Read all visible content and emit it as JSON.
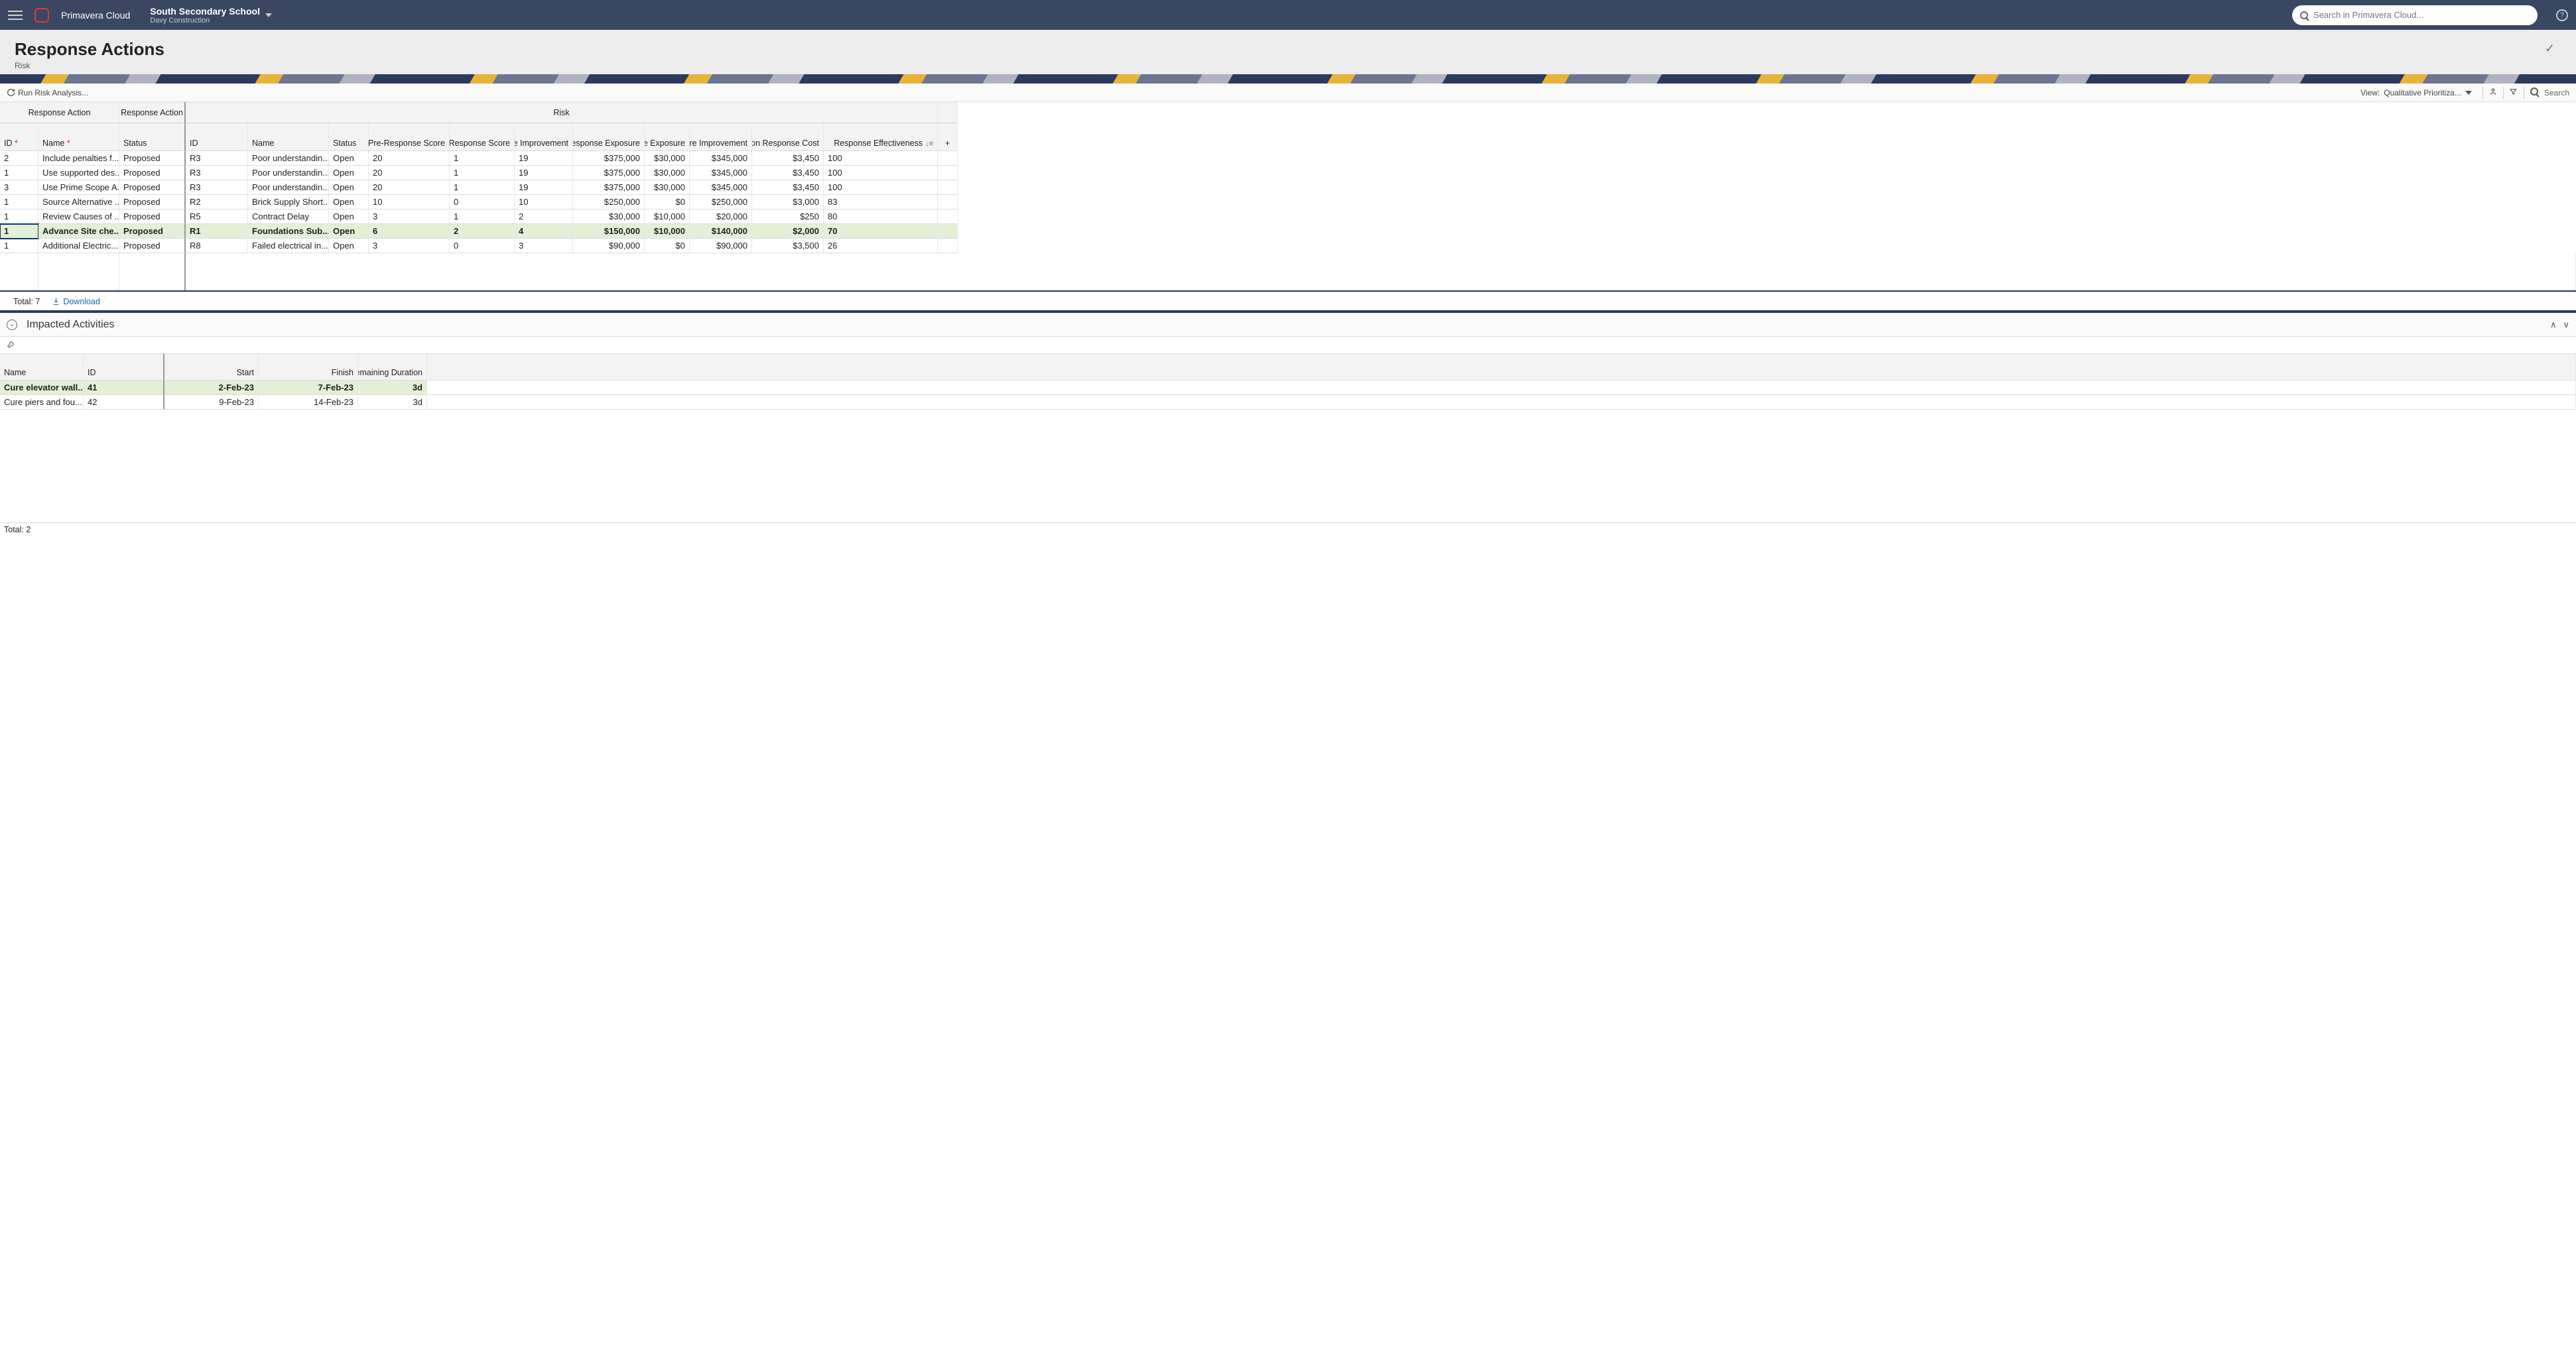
{
  "topbar": {
    "brand": "Primavera Cloud",
    "project": "South Secondary School",
    "company": "Davy Construction",
    "search_placeholder": "Search in Primavera Cloud...",
    "help": "?"
  },
  "page": {
    "title": "Response Actions",
    "sub": "Risk"
  },
  "toolbar": {
    "run": "Run Risk Analysis...",
    "view_label": "View:",
    "view_value": "Qualitative Prioritiza...",
    "search": "Search"
  },
  "grid": {
    "group_ra": "Response Action",
    "group_ra2": "Response Action",
    "group_risk": "Risk",
    "cols": {
      "id": "ID",
      "name": "Name",
      "status": "Status",
      "rid": "ID",
      "rname": "Name",
      "rstatus": "Status",
      "pre_score": "Project Pre-Response Score",
      "post_score": "Project Post-Response Score",
      "score_imp": "Score Improvement",
      "pre_exp": "Pre-Response Exposure",
      "post_exp": "Post-Response Exposure",
      "exp_imp": "Exposure Improvement",
      "tac": "Total At Completion Response Cost",
      "eff": "Response Effectiveness"
    },
    "rows": [
      {
        "id": "2",
        "name": "Include penalties f...",
        "status": "Proposed",
        "rid": "R3",
        "rname": "Poor understandin...",
        "rstatus": "Open",
        "pre": "20",
        "post": "1",
        "imp": "19",
        "pexp": "$375,000",
        "poexp": "$30,000",
        "eimp": "$345,000",
        "tac": "$3,450",
        "eff": "100"
      },
      {
        "id": "1",
        "name": "Use supported des...",
        "status": "Proposed",
        "rid": "R3",
        "rname": "Poor understandin...",
        "rstatus": "Open",
        "pre": "20",
        "post": "1",
        "imp": "19",
        "pexp": "$375,000",
        "poexp": "$30,000",
        "eimp": "$345,000",
        "tac": "$3,450",
        "eff": "100"
      },
      {
        "id": "3",
        "name": "Use Prime Scope A...",
        "status": "Proposed",
        "rid": "R3",
        "rname": "Poor understandin...",
        "rstatus": "Open",
        "pre": "20",
        "post": "1",
        "imp": "19",
        "pexp": "$375,000",
        "poexp": "$30,000",
        "eimp": "$345,000",
        "tac": "$3,450",
        "eff": "100"
      },
      {
        "id": "1",
        "name": "Source Alternative ...",
        "status": "Proposed",
        "rid": "R2",
        "rname": "Brick Supply Short...",
        "rstatus": "Open",
        "pre": "10",
        "post": "0",
        "imp": "10",
        "pexp": "$250,000",
        "poexp": "$0",
        "eimp": "$250,000",
        "tac": "$3,000",
        "eff": "83"
      },
      {
        "id": "1",
        "name": "Review Causes of ...",
        "status": "Proposed",
        "rid": "R5",
        "rname": "Contract Delay",
        "rstatus": "Open",
        "pre": "3",
        "post": "1",
        "imp": "2",
        "pexp": "$30,000",
        "poexp": "$10,000",
        "eimp": "$20,000",
        "tac": "$250",
        "eff": "80"
      },
      {
        "id": "1",
        "name": "Advance Site che...",
        "status": "Proposed",
        "rid": "R1",
        "rname": "Foundations Sub...",
        "rstatus": "Open",
        "pre": "6",
        "post": "2",
        "imp": "4",
        "pexp": "$150,000",
        "poexp": "$10,000",
        "eimp": "$140,000",
        "tac": "$2,000",
        "eff": "70",
        "sel": true
      },
      {
        "id": "1",
        "name": "Additional Electric...",
        "status": "Proposed",
        "rid": "R8",
        "rname": "Failed electrical in...",
        "rstatus": "Open",
        "pre": "3",
        "post": "0",
        "imp": "3",
        "pexp": "$90,000",
        "poexp": "$0",
        "eimp": "$90,000",
        "tac": "$3,500",
        "eff": "26"
      }
    ],
    "total_label": "Total: 7",
    "download": "Download"
  },
  "panel": {
    "title": "Impacted Activities",
    "cols": {
      "name": "Name",
      "id": "ID",
      "start": "Start",
      "finish": "Finish",
      "rd": "Remaining Duration"
    },
    "rows": [
      {
        "name": "Cure elevator wall...",
        "id": "41",
        "start": "2-Feb-23",
        "finish": "7-Feb-23",
        "rd": "3d",
        "sel": true
      },
      {
        "name": "Cure piers and fou...",
        "id": "42",
        "start": "9-Feb-23",
        "finish": "14-Feb-23",
        "rd": "3d"
      }
    ],
    "total_label": "Total: 2"
  }
}
